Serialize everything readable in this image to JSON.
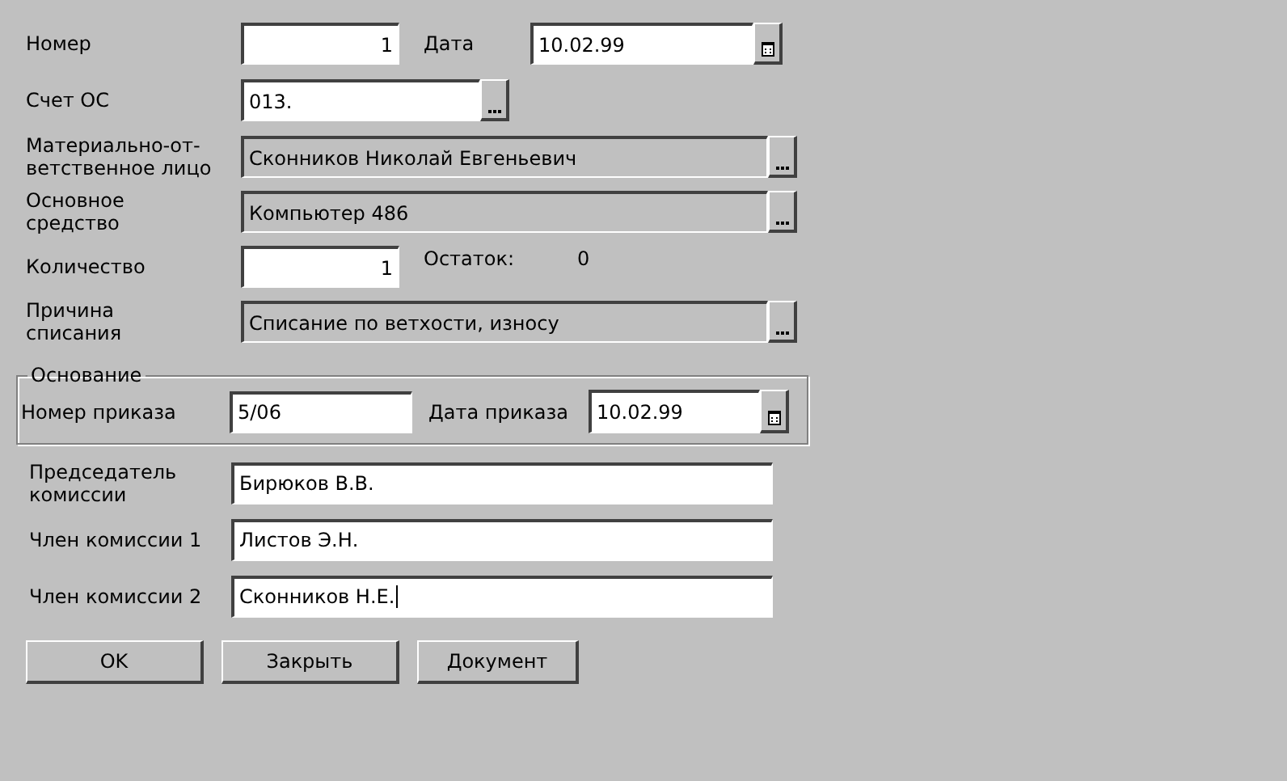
{
  "number": {
    "label": "Номер",
    "value": "1"
  },
  "date": {
    "label": "Дата",
    "value": "10.02.99"
  },
  "account": {
    "label": "Счет ОС",
    "value": "013."
  },
  "lookups": [
    {
      "label": "Материально-от-\nветственное лицо",
      "value": "Сконников Николай Евгеньевич",
      "readonly": true
    },
    {
      "label": "Основное\nсредство",
      "value": "Компьютер 486",
      "readonly": true
    }
  ],
  "quantity": {
    "label": "Количество",
    "value": "1"
  },
  "remainder": {
    "label": "Остаток:",
    "value": "0"
  },
  "reason": {
    "label": "Причина\nсписания",
    "value": "Списание по ветхости, износу",
    "readonly": true
  },
  "basis": {
    "title": "Основание",
    "order_number": {
      "label": "Номер приказа",
      "value": "5/06"
    },
    "order_date": {
      "label": "Дата приказа",
      "value": "10.02.99"
    }
  },
  "commission": [
    {
      "label": "Председатель\nкомиссии",
      "value": "Бирюков В.В.",
      "focused": false
    },
    {
      "label": "Член комиссии 1",
      "value": "Листов Э.Н.",
      "focused": false
    },
    {
      "label": "Член комиссии 2",
      "value": "Сконников Н.Е.",
      "focused": true
    }
  ],
  "buttons": [
    "OK",
    "Закрыть",
    "Документ"
  ]
}
